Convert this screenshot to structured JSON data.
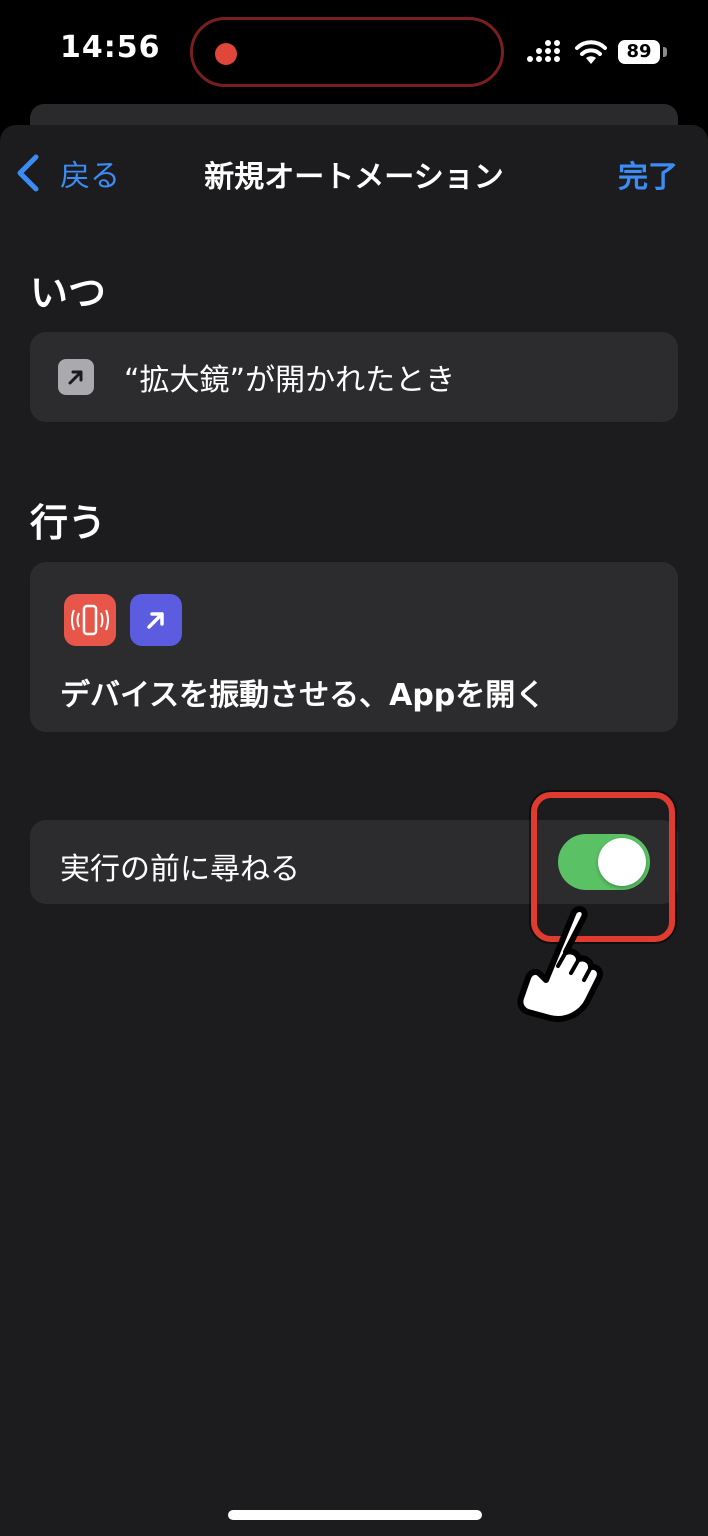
{
  "status_bar": {
    "time": "14:56",
    "battery": "89",
    "recording_color": "#e0473a",
    "icons": [
      "signal-icon",
      "wifi-icon",
      "battery-icon"
    ]
  },
  "nav": {
    "back_label": "戻る",
    "title": "新規オートメーション",
    "done_label": "完了",
    "accent": "#3b8cf5"
  },
  "when_section": {
    "heading": "いつ",
    "trigger_text": "“拡大鏡”が開かれたとき",
    "icon": "open-app-icon"
  },
  "do_section": {
    "heading": "行う",
    "action_icons": [
      "vibrate-device-icon",
      "open-app-icon"
    ],
    "action_text": "デバイスを振動させる、Appを開く"
  },
  "settings": {
    "ask_before_running_label": "実行の前に尋ねる",
    "ask_before_running_on": true,
    "toggle_color": "#5ac264"
  },
  "annotation": {
    "highlight_color": "#e03b30",
    "pointer": "pointing-hand-icon"
  }
}
